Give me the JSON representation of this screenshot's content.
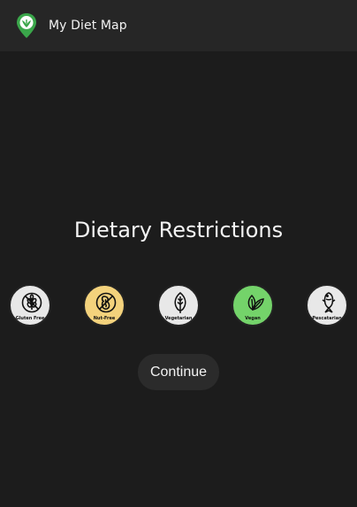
{
  "app": {
    "title": "My Diet Map",
    "logo_icon": "map-pin-leaf-icon"
  },
  "heading": "Dietary Restrictions",
  "restrictions": [
    {
      "label": "Gluten Free",
      "icon": "wheat-crossed-icon",
      "selected": false,
      "color": "#e8e8e8"
    },
    {
      "label": "Nut-Free",
      "icon": "nut-crossed-icon",
      "selected": true,
      "color": "#f3d27c"
    },
    {
      "label": "Vegetarian",
      "icon": "leaf-outline-icon",
      "selected": false,
      "color": "#e8e8e8"
    },
    {
      "label": "Vegan",
      "icon": "leaves-icon",
      "selected": true,
      "color": "#74d36a"
    },
    {
      "label": "Pescatarian",
      "icon": "fish-icon",
      "selected": false,
      "color": "#e8e8e8"
    }
  ],
  "continue_label": "Continue",
  "colors": {
    "background": "#1c1c1c",
    "appbar": "#262626",
    "button": "#2b2b2b",
    "brand_green": "#3aa64a"
  }
}
